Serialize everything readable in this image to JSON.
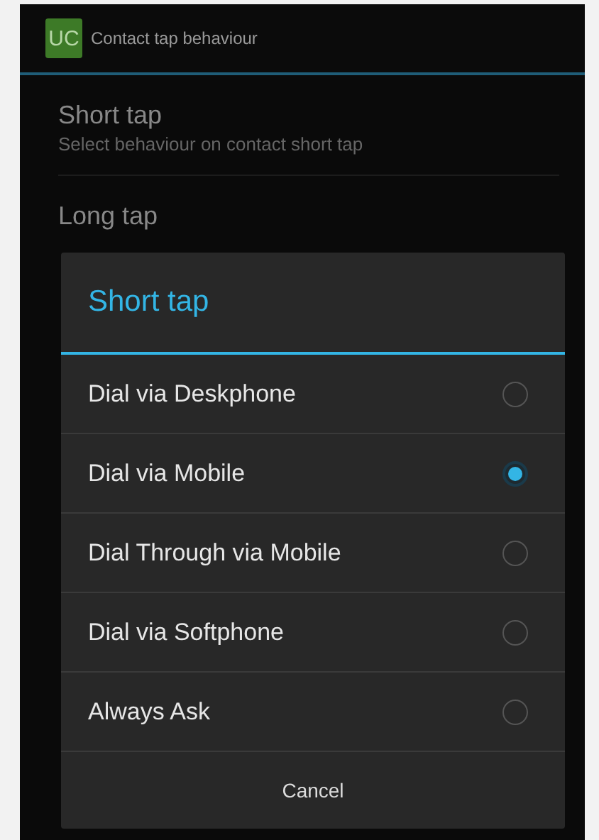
{
  "action_bar": {
    "app_icon": "UC",
    "title": "Contact tap behaviour"
  },
  "preferences": [
    {
      "title": "Short tap",
      "summary": "Select behaviour on contact short tap"
    },
    {
      "title": "Long tap"
    }
  ],
  "dialog": {
    "title": "Short tap",
    "options": [
      {
        "label": "Dial via Deskphone",
        "selected": false
      },
      {
        "label": "Dial via Mobile",
        "selected": true
      },
      {
        "label": "Dial Through via Mobile",
        "selected": false
      },
      {
        "label": "Dial via Softphone",
        "selected": false
      },
      {
        "label": "Always Ask",
        "selected": false
      }
    ],
    "cancel": "Cancel"
  }
}
